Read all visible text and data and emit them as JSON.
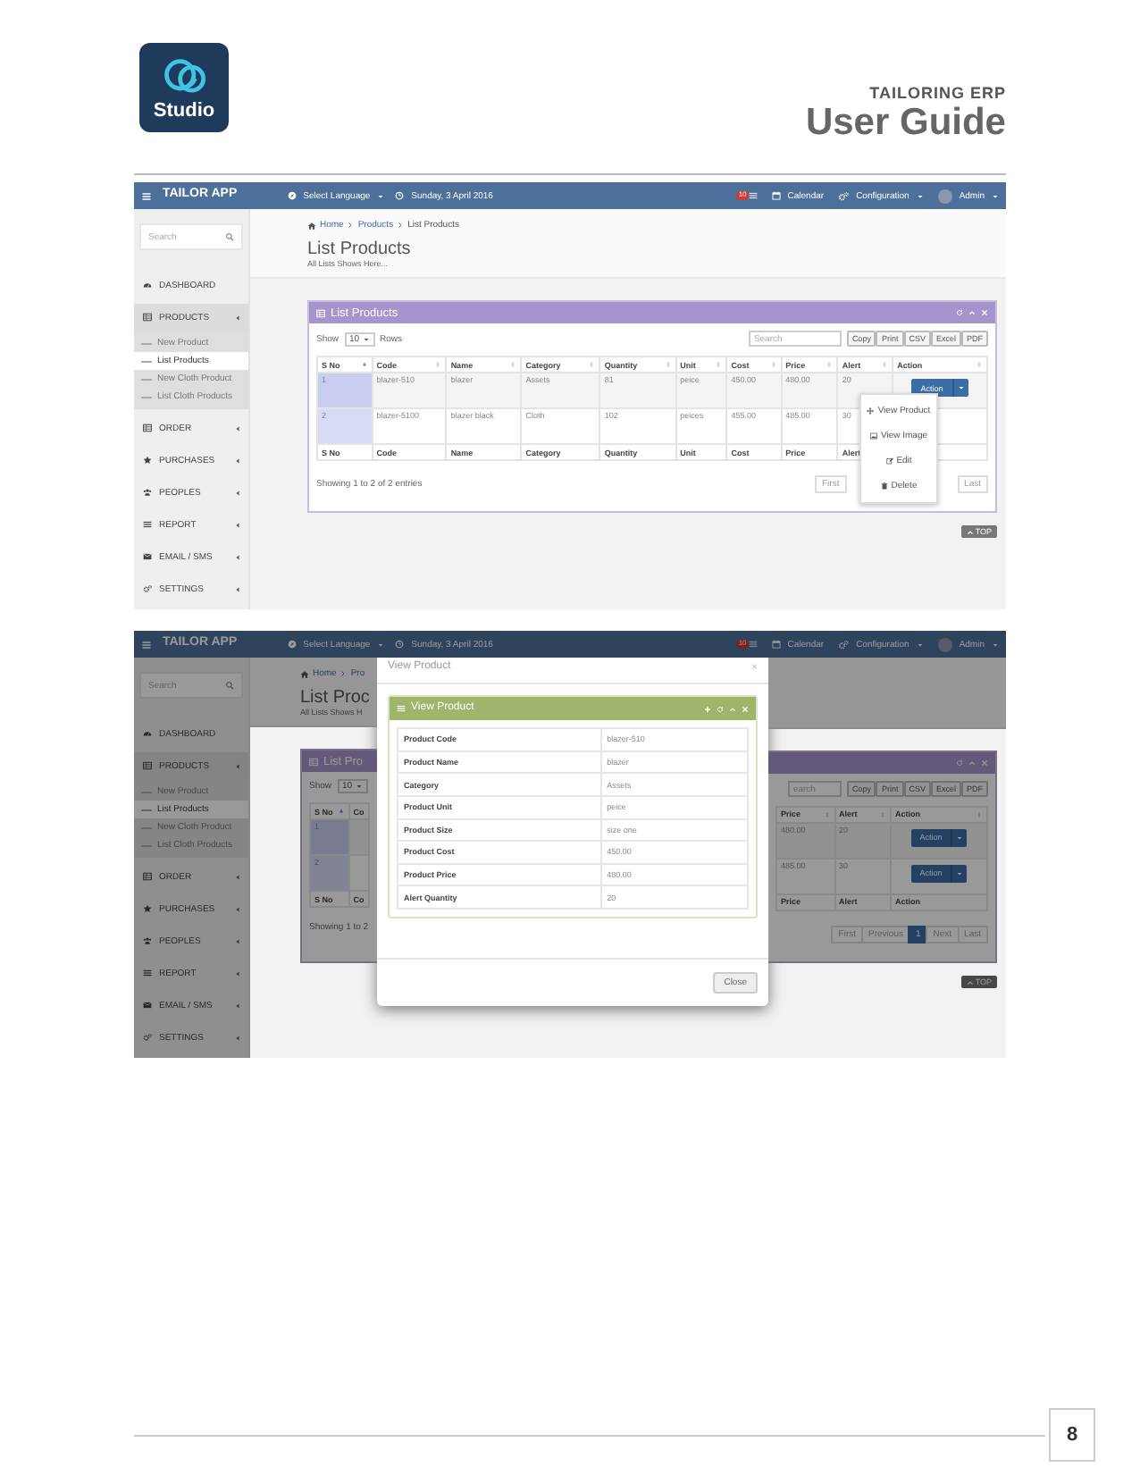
{
  "doc_header": {
    "logo_text": "Studio",
    "subtitle": "TAILORING ERP",
    "title": "User Guide"
  },
  "list_screen": {
    "navbar": {
      "brand": "TAILOR APP",
      "language": "Select Language",
      "date": "Sunday, 3 April 2016",
      "notification_count": "10",
      "calendar": "Calendar",
      "configuration": "Configuration",
      "user": "Admin"
    },
    "sidebar": {
      "search_placeholder": "Search",
      "items": [
        {
          "label": "DASHBOARD",
          "kind": "link",
          "selected": false
        },
        {
          "label": "PRODUCTS",
          "kind": "menu",
          "selected": true,
          "children": [
            {
              "label": "New Product",
              "selected": false
            },
            {
              "label": "List Products",
              "selected": true
            },
            {
              "label": "New Cloth Product",
              "selected": false
            },
            {
              "label": "List Cloth Products",
              "selected": false
            }
          ]
        },
        {
          "label": "ORDER",
          "kind": "menu",
          "selected": false
        },
        {
          "label": "PURCHASES",
          "kind": "menu",
          "selected": false
        },
        {
          "label": "PEOPLES",
          "kind": "menu",
          "selected": false
        },
        {
          "label": "REPORT",
          "kind": "menu",
          "selected": false
        },
        {
          "label": "EMAIL / SMS",
          "kind": "menu",
          "selected": false
        },
        {
          "label": "SETTINGS",
          "kind": "menu",
          "selected": false
        }
      ]
    },
    "breadcrumb": [
      "Home",
      "Products",
      "List Products"
    ],
    "page_title": "List Products",
    "page_subtitle": "All Lists Shows Here...",
    "card": {
      "title": "List Products",
      "show_label": "Show",
      "page_size": "10",
      "rows_label": "Rows",
      "search_placeholder": "Search",
      "export_buttons": [
        "Copy",
        "Print",
        "CSV",
        "Excel",
        "PDF"
      ],
      "columns": [
        {
          "label": "S No",
          "sorted": true
        },
        {
          "label": "Code",
          "sorted": false
        },
        {
          "label": "Name",
          "sorted": false
        },
        {
          "label": "Category",
          "sorted": false
        },
        {
          "label": "Quantity",
          "sorted": false
        },
        {
          "label": "Unit",
          "sorted": false
        },
        {
          "label": "Cost",
          "sorted": false
        },
        {
          "label": "Price",
          "sorted": false
        },
        {
          "label": "Alert",
          "sorted": false
        },
        {
          "label": "Action",
          "kind": "action",
          "sorted": false
        }
      ],
      "rows": [
        {
          "cells": [
            "1",
            "blazer-510",
            "blazer",
            "Assets",
            "81",
            "peice",
            "450.00",
            "480.00",
            "20"
          ],
          "action": "Action"
        },
        {
          "cells": [
            "2",
            "blazer-5100",
            "blazer black",
            "Cloth",
            "102",
            "peices",
            "455.00",
            "485.00",
            "30"
          ]
        }
      ],
      "footer": [
        "S No",
        "Code",
        "Name",
        "Category",
        "Quantity",
        "Unit",
        "Cost",
        "Price",
        "Alert"
      ],
      "info": "Showing 1 to 2 of 2 entries",
      "pagination": [
        {
          "label": "First",
          "selected": false
        },
        {
          "label": "Last",
          "selected": false
        }
      ]
    },
    "action_menu": [
      "View Product",
      "View Image",
      "Edit",
      "Delete"
    ],
    "top_button": "TOP"
  },
  "modal_screen": {
    "navbar": {
      "brand": "TAILOR APP",
      "language": "Select Language",
      "date": "Sunday, 3 April 2016",
      "notification_count": "10",
      "calendar": "Calendar",
      "configuration": "Configuration",
      "user": "Admin"
    },
    "sidebar": {
      "search_placeholder": "Search",
      "items": [
        {
          "label": "DASHBOARD",
          "kind": "link",
          "selected": false
        },
        {
          "label": "PRODUCTS",
          "kind": "menu",
          "selected": true,
          "children": [
            {
              "label": "New Product",
              "selected": false
            },
            {
              "label": "List Products",
              "selected": true
            },
            {
              "label": "New Cloth Product",
              "selected": false
            },
            {
              "label": "List Cloth Products",
              "selected": false
            }
          ]
        },
        {
          "label": "ORDER",
          "kind": "menu",
          "selected": false
        },
        {
          "label": "PURCHASES",
          "kind": "menu",
          "selected": false
        },
        {
          "label": "PEOPLES",
          "kind": "menu",
          "selected": false
        },
        {
          "label": "REPORT",
          "kind": "menu",
          "selected": false
        },
        {
          "label": "EMAIL / SMS",
          "kind": "menu",
          "selected": false
        },
        {
          "label": "SETTINGS",
          "kind": "menu",
          "selected": false
        }
      ]
    },
    "left_fragment": {
      "breadcrumb": [
        "Home",
        "Pro"
      ],
      "page_title": "List Proc",
      "page_subtitle": "All Lists Shows H",
      "card_title": "List Pro",
      "show_label": "Show",
      "page_size": "10",
      "columns": [
        {
          "label": "S No",
          "sorted": true
        },
        {
          "label": "Co",
          "sorted": false,
          "cut": true
        }
      ],
      "rows": [
        {
          "cells": [
            "1"
          ]
        },
        {
          "cells": [
            "2"
          ]
        }
      ],
      "footer": [
        "S No",
        "Co"
      ],
      "info": "Showing 1 to 2"
    },
    "right_fragment": {
      "search_placeholder": "earch",
      "export_buttons": [
        "Copy",
        "Print",
        "CSV",
        "Excel",
        "PDF"
      ],
      "columns": [
        {
          "label": "Price",
          "sorted": false
        },
        {
          "label": "Alert",
          "sorted": false
        },
        {
          "label": "Action",
          "kind": "action",
          "sorted": false
        }
      ],
      "rows": [
        {
          "cells": [
            "480.00",
            "20"
          ],
          "action": "Action"
        },
        {
          "cells": [
            "485.00",
            "30"
          ],
          "action": "Action"
        }
      ],
      "footer": [
        "Price",
        "Alert",
        "Action"
      ],
      "pagination": [
        {
          "label": "First",
          "selected": false
        },
        {
          "label": "Previous",
          "selected": false
        },
        {
          "label": "1",
          "selected": true
        },
        {
          "label": "Next",
          "selected": false
        },
        {
          "label": "Last",
          "selected": false
        }
      ],
      "top_button": "TOP"
    },
    "modal": {
      "title": "View Product",
      "close_symbol": "×",
      "panel_title": "View Product",
      "fields": [
        {
          "label": "Product Code",
          "value": "blazer-510"
        },
        {
          "label": "Product Name",
          "value": "blazer"
        },
        {
          "label": "Category",
          "value": "Assets"
        },
        {
          "label": "Product Unit",
          "value": "peice"
        },
        {
          "label": "Product Size",
          "value": "size one"
        },
        {
          "label": "Product Cost",
          "value": "450.00"
        },
        {
          "label": "Product Price",
          "value": "480.00"
        },
        {
          "label": "Alert Quantity",
          "value": "20"
        }
      ],
      "close_button": "Close"
    }
  },
  "page_number": "8"
}
